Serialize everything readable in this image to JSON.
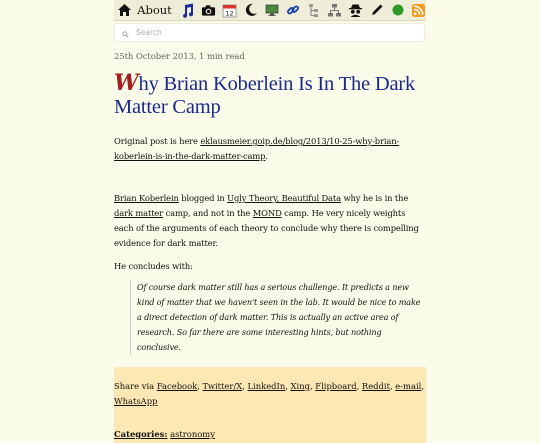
{
  "toolbar": {
    "about_label": "About",
    "icons": [
      "home-icon",
      "music-icon",
      "camera-icon",
      "calendar-icon",
      "moon-icon",
      "screen-icon",
      "link-icon",
      "tree-icon",
      "network-icon",
      "spy-icon",
      "pen-icon",
      "green-dot-icon",
      "rss-icon"
    ],
    "calendar_day": "12"
  },
  "search": {
    "placeholder": "Search"
  },
  "post": {
    "date": "25th October 2013, 1 min read",
    "title_dropcap": "W",
    "title_rest": "hy Brian Koberlein Is In The Dark Matter Camp",
    "original_prefix": "Original post is here ",
    "original_link": "eklausmeier.goip.de/blog/2013/10-25-why-brian-koberlein-is-in-the-dark-matter-camp",
    "original_suffix": ".",
    "p2_link_author": "Brian Koberlein",
    "p2_text1": " blogged in ",
    "p2_link_blog": "Ugly Theory, Beautiful Data",
    "p2_text2": " why he is in the ",
    "p2_link_dm": "dark matter",
    "p2_text3": " camp, and not in the ",
    "p2_link_mond": "MOND",
    "p2_text4": " camp. He very nicely weights each of the arguments of each theory to conclude why there is compelling evidence for dark matter.",
    "concludes": "He concludes with:",
    "quote": "Of course dark matter still has a serious challenge. It predicts a new kind of matter that we haven't seen in the lab. It would be nice to make a direct detection of dark matter. This is actually an active area of research. So far there are some interesting hints, but nothing conclusive."
  },
  "share": {
    "prefix": "Share via ",
    "links": [
      "Facebook",
      "Twitter/X",
      "LinkedIn",
      "Xing",
      "Flipboard",
      "Reddit",
      "e-mail",
      "WhatsApp"
    ]
  },
  "categories": {
    "label": "Categories:",
    "value": "astronomy"
  },
  "colors": {
    "title": "#1a2a8c",
    "dropcap": "#a31f1f",
    "share_bg": "#fde8b4",
    "page_bg": "#fbfbe9"
  }
}
